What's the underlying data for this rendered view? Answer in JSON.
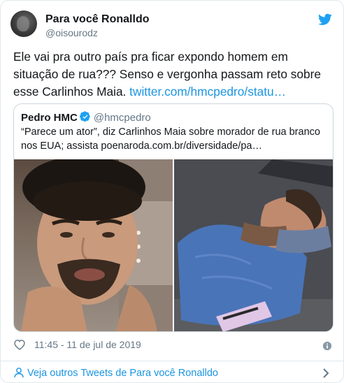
{
  "tweet": {
    "author": {
      "display_name": "Para você Ronalldo",
      "handle": "@oisourodz",
      "avatar_icon": "user-avatar"
    },
    "brand_icon": "twitter-bird-icon",
    "brand_color": "#1da1f2",
    "text": "Ele vai pra outro país pra ficar expondo homem em situação de rua??? Senso e vergonha passam reto sobre esse Carlinhos Maia. ",
    "link_text": "twitter.com/hmcpedro/statu…",
    "link_color": "#1b95e0",
    "quoted": {
      "display_name": "Pedro HMC",
      "verified": true,
      "handle": "@hmcpedro",
      "text": "“Parece um ator”, diz Carlinhos Maia sobre morador de rua branco nos EUA; assista poenaroda.com.br/diversidade/pa…",
      "media": [
        {
          "icon": "selfie-photo"
        },
        {
          "icon": "sleeping-man-photo"
        }
      ]
    },
    "footer": {
      "like_icon": "heart-icon",
      "timestamp": "11:45 - 11 de jul de 2019",
      "info_icon": "info-icon"
    },
    "more_tweets": {
      "icon": "person-icon",
      "label": "Veja outros Tweets de Para você Ronalldo",
      "chevron_icon": "chevron-right-icon"
    }
  }
}
